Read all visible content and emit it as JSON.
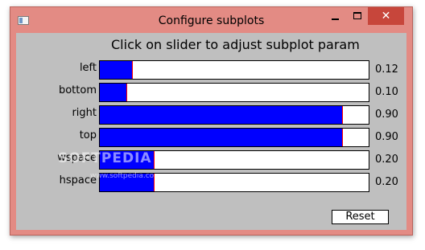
{
  "window": {
    "title": "Configure subplots",
    "close_glyph": "✕"
  },
  "heading": "Click on slider to adjust subplot param",
  "sliders": [
    {
      "label": "left",
      "value": 0.12,
      "value_text": "0.12"
    },
    {
      "label": "bottom",
      "value": 0.1,
      "value_text": "0.10"
    },
    {
      "label": "right",
      "value": 0.9,
      "value_text": "0.90"
    },
    {
      "label": "top",
      "value": 0.9,
      "value_text": "0.90"
    },
    {
      "label": "wspace",
      "value": 0.2,
      "value_text": "0.20"
    },
    {
      "label": "hspace",
      "value": 0.2,
      "value_text": "0.20"
    }
  ],
  "reset_label": "Reset",
  "watermark": {
    "text": "SOFTPEDIA",
    "url": "www.softpedia.com"
  },
  "colors": {
    "fill": "#0000ff",
    "marker": "#ff0000",
    "background": "#bfbfbf",
    "frame": "#e38b84"
  }
}
